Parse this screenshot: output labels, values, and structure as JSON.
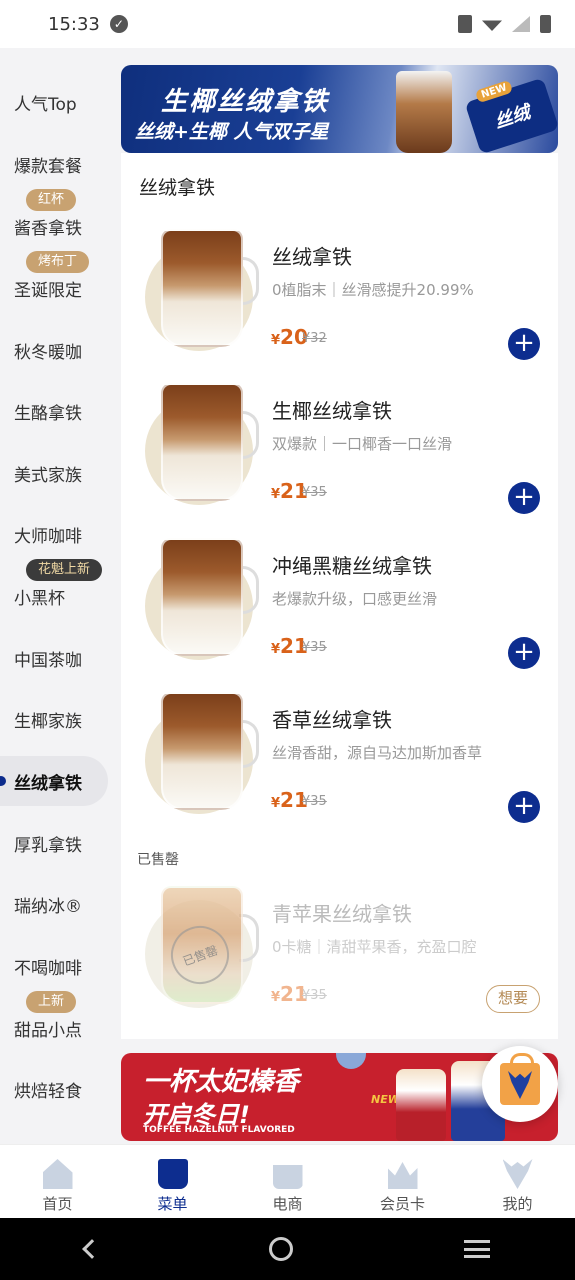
{
  "status": {
    "time": "15:33"
  },
  "sidebar": {
    "items": [
      {
        "label": "人气Top"
      },
      {
        "label": "爆款套餐"
      },
      {
        "label": "酱香拿铁",
        "badge": "红杯"
      },
      {
        "label": "圣诞限定",
        "badge": "烤布丁"
      },
      {
        "label": "秋冬暖咖"
      },
      {
        "label": "生酪拿铁"
      },
      {
        "label": "美式家族"
      },
      {
        "label": "大师咖啡"
      },
      {
        "label": "小黑杯",
        "badge": "花魁上新"
      },
      {
        "label": "中国茶咖"
      },
      {
        "label": "生椰家族"
      },
      {
        "label": "丝绒拿铁",
        "active": true
      },
      {
        "label": "厚乳拿铁"
      },
      {
        "label": "瑞纳冰®"
      },
      {
        "label": "不喝咖啡"
      },
      {
        "label": "甜品小点",
        "badge": "上新"
      },
      {
        "label": "烘焙轻食"
      }
    ]
  },
  "banner_top": {
    "title": "生椰丝绒拿铁",
    "subtitle": "丝绒+生椰 人气双子星",
    "tag": "丝绒",
    "new": "NEW"
  },
  "section": {
    "title": "丝绒拿铁"
  },
  "products": [
    {
      "name": "丝绒拿铁",
      "desc": "0植脂末｜丝滑感提升20.99%",
      "currency": "¥",
      "price": "20",
      "original": "¥32"
    },
    {
      "name": "生椰丝绒拿铁",
      "desc": "双爆款｜一口椰香一口丝滑",
      "currency": "¥",
      "price": "21",
      "original": "¥35"
    },
    {
      "name": "冲绳黑糖丝绒拿铁",
      "desc": "老爆款升级，口感更丝滑",
      "currency": "¥",
      "price": "21",
      "original": "¥35"
    },
    {
      "name": "香草丝绒拿铁",
      "desc": "丝滑香甜，源自马达加斯加香草",
      "currency": "¥",
      "price": "21",
      "original": "¥35"
    }
  ],
  "soldout": {
    "label": "已售罄",
    "stamp": "已售罄",
    "product": {
      "name": "青苹果丝绒拿铁",
      "desc": "0卡糖｜清甜苹果香，充盈口腔",
      "currency": "¥",
      "price": "21",
      "original": "¥35",
      "action": "想要"
    }
  },
  "banner_bottom": {
    "title": "一杯太妃榛香",
    "subtitle": "开启冬日!",
    "english": "TOFFEE HAZELNUT FLAVORED",
    "new": "NEW"
  },
  "tabbar": {
    "tabs": [
      {
        "label": "首页"
      },
      {
        "label": "菜单",
        "active": true
      },
      {
        "label": "电商"
      },
      {
        "label": "会员卡"
      },
      {
        "label": "我的"
      }
    ]
  },
  "colors": {
    "brand": "#0d2d8f",
    "price": "#d9621a",
    "badge_gold": "#c8a271",
    "badge_dark": "#3b3b3b",
    "promo_red": "#c7202d"
  }
}
